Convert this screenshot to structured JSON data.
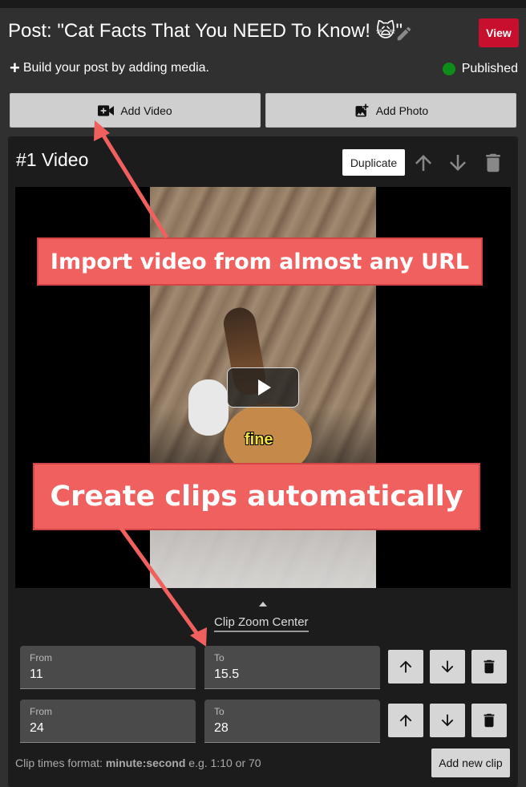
{
  "header": {
    "title": "Post: \"Cat Facts That You NEED To Know! 🙀\"",
    "edit_icon": "pencil-icon",
    "view_label": "View",
    "view_color": "#c8102e"
  },
  "build": {
    "text": "Build your post by adding media.",
    "icon": "plus-icon"
  },
  "status": {
    "label": "Published",
    "color": "#0f8c1a"
  },
  "media_buttons": {
    "add_video_label": "Add Video",
    "add_photo_label": "Add Photo"
  },
  "card": {
    "title": "#1 Video",
    "duplicate_label": "Duplicate"
  },
  "video": {
    "caption": "fine"
  },
  "callouts": {
    "first": "Import video from almost any URL",
    "second": "Create clips automatically",
    "color": "#f0605f"
  },
  "clip_zoom": {
    "label": "Clip Zoom Center"
  },
  "clips": [
    {
      "from_label": "From",
      "from_value": "11",
      "to_label": "To",
      "to_value": "15.5"
    },
    {
      "from_label": "From",
      "from_value": "24",
      "to_label": "To",
      "to_value": "28"
    }
  ],
  "footer": {
    "format_prefix": "Clip times format:",
    "format_bold": "minute:second",
    "format_suffix": "e.g. 1:10 or 70",
    "add_clip_label": "Add new clip"
  }
}
